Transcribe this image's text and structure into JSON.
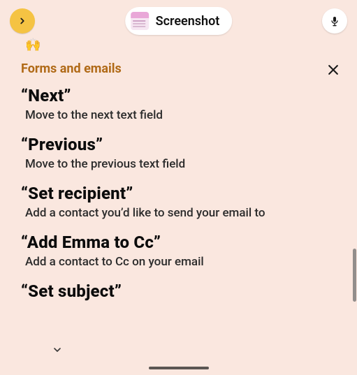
{
  "header": {
    "pill_label": "Screenshot",
    "forward_icon": "chevron-right",
    "mic_icon": "microphone"
  },
  "emoji_strip": "🙌",
  "section": {
    "title": "Forms and emails",
    "close_icon": "close"
  },
  "commands": [
    {
      "title": "“Next”",
      "desc": "Move to the next text field"
    },
    {
      "title": "“Previous”",
      "desc": "Move to the previous text field"
    },
    {
      "title": "“Set recipient”",
      "desc": "Add a contact you’d like to send your email to"
    },
    {
      "title": "“Add Emma to Cc”",
      "desc": "Add a contact to Cc on your email"
    },
    {
      "title": "“Set subject”",
      "desc": ""
    }
  ],
  "expand_icon": "chevron-down"
}
